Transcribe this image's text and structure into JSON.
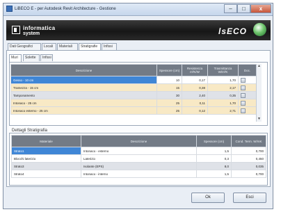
{
  "window": {
    "title": "LiBECO E - per Autodesk Revit Architecture - Gestione",
    "min_label": "–",
    "max_label": "□",
    "close_label": "x"
  },
  "banner": {
    "logo_line1": "informatica",
    "logo_line2": "system",
    "brand": "lsECO"
  },
  "main_tabs": [
    "Dati Geografici",
    "Locali",
    "Materiali",
    "Stratigrafie",
    "Infissi"
  ],
  "sub_tabs": [
    "Muri",
    "Solette",
    "Infissi"
  ],
  "layers_table": {
    "headers": [
      "Descrizione",
      "Spessore (cm)",
      "Resistenza m²K/W",
      "Trasmittanza W/m²K",
      "Doc."
    ],
    "rows": [
      {
        "desc": "Gesso - 10 cm",
        "s": "10",
        "r": "0,17",
        "u": "1,70",
        "style": "sel"
      },
      {
        "desc": "Tramezza - 15 cm",
        "s": "15",
        "r": "0,38",
        "u": "2,17",
        "style": "yellow"
      },
      {
        "desc": "Tamponamento",
        "s": "30",
        "r": "2,40",
        "u": "0,35",
        "style": "gray"
      },
      {
        "desc": "Intonaco - 25 cm",
        "s": "25",
        "r": "0,11",
        "u": "1,70",
        "style": "yellow"
      },
      {
        "desc": "Intonaco esterno - 25 cm",
        "s": "25",
        "r": "0,12",
        "u": "2,71",
        "style": "yellow"
      }
    ]
  },
  "details": {
    "title": "Dettagli Stratigrafia",
    "headers": [
      "Materiale",
      "Descrizione",
      "Spessore (cm)",
      "Cond. Term. W/mK"
    ],
    "rows": [
      {
        "mat": "Strato1",
        "desc": "Intonaco - esterno",
        "s": "1,5",
        "k": "0,700",
        "style": "sel"
      },
      {
        "mat": "Blocchi laterizio",
        "desc": "Laterizio",
        "s": "0,3",
        "k": "0,450",
        "style": "white"
      },
      {
        "mat": "Strato3",
        "desc": "Isolante (EPS)",
        "s": "8,0",
        "k": "0,035",
        "style": "gray"
      },
      {
        "mat": "Strato4",
        "desc": "Intonaco - interno",
        "s": "1,5",
        "k": "0,700",
        "style": "white"
      }
    ]
  },
  "buttons": {
    "ok": "Ok",
    "exit": "Esci"
  }
}
